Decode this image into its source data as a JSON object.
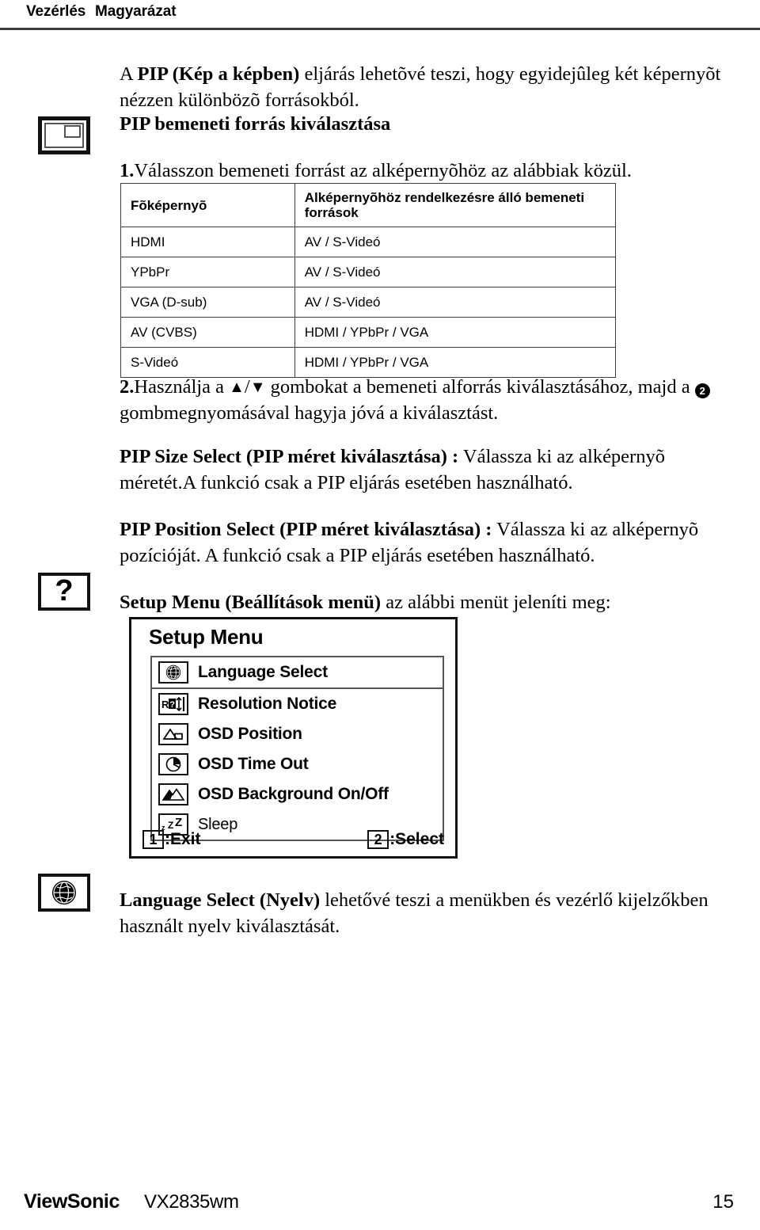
{
  "header": {
    "col1": "Vezérlés",
    "col2": "Magyarázat"
  },
  "margin_icons": {
    "pip": "pip-picture-in-picture-icon",
    "question": "?",
    "globe": "globe-icon"
  },
  "intro": {
    "bold_lead": "A ",
    "bold_term": "PIP (Kép a képben)",
    "rest": " eljárás lehetõvé teszi, hogy egyidejûleg két képernyõt nézzen különbözõ forrásokból."
  },
  "pip_source_heading": "PIP bemeneti forrás kiválasztása",
  "step1": {
    "num": "1.",
    "text": "Válasszon bemeneti forrást az alképernyõhöz az alábbiak közül."
  },
  "table": {
    "headers": [
      "Fõképernyõ",
      "Alképernyõhöz rendelkezésre álló bemeneti források"
    ],
    "rows": [
      [
        "HDMI",
        "AV / S-Videó"
      ],
      [
        "YPbPr",
        "AV / S-Videó"
      ],
      [
        "VGA (D-sub)",
        "AV / S-Videó"
      ],
      [
        "AV (CVBS)",
        "HDMI / YPbPr / VGA"
      ],
      [
        "S-Videó",
        "HDMI / YPbPr / VGA"
      ]
    ]
  },
  "step2": {
    "num": "2.",
    "part1": "Használja a ",
    "up_glyph": "▲",
    "slash": "/",
    "down_glyph": "▼",
    "part2": " gombokat a bemeneti alforrás kiválasztásához, majd a ",
    "button_glyph": "2",
    "part3": " gombmegnyomásával hagyja jóvá a kiválasztást."
  },
  "pip_size": {
    "term": "PIP Size Select (PIP méret kiválasztása) :",
    "text": " Válassza ki az alképernyõ méretét.A funkció csak a PIP eljárás esetében használható."
  },
  "pip_position": {
    "term": "PIP Position Select (PIP méret kiválasztása) :",
    "text": " Válassza ki az alképernyõ pozícióját. A funkció csak a PIP eljárás esetében használható."
  },
  "setup_menu_para": {
    "term": "Setup Menu (Beállítások menü)",
    "text": " az alábbi menüt jeleníti meg:"
  },
  "osd": {
    "title": "Setup Menu",
    "items": [
      {
        "label": "Language Select",
        "icon": "globe-icon"
      },
      {
        "label": "Resolution Notice",
        "icon": "resolution-icon"
      },
      {
        "label": "OSD Position",
        "icon": "osd-position-icon"
      },
      {
        "label": "OSD Time Out",
        "icon": "clock-icon"
      },
      {
        "label": "OSD Background On/Off",
        "icon": "mountain-image-icon"
      },
      {
        "label": "Sleep",
        "icon": "zzz-sleep-icon"
      }
    ],
    "footer": {
      "exit_key": "1",
      "exit_label": ":Exit",
      "select_key": "2",
      "select_label": ":Select"
    }
  },
  "language_select": {
    "term": "Language Select (Nyelv)",
    "text": " lehetővé teszi a menükben és vezérlő kijelzőkben használt nyelv kiválasztását."
  },
  "footer": {
    "brand": "ViewSonic",
    "model": "VX2835wm",
    "page": "15"
  }
}
